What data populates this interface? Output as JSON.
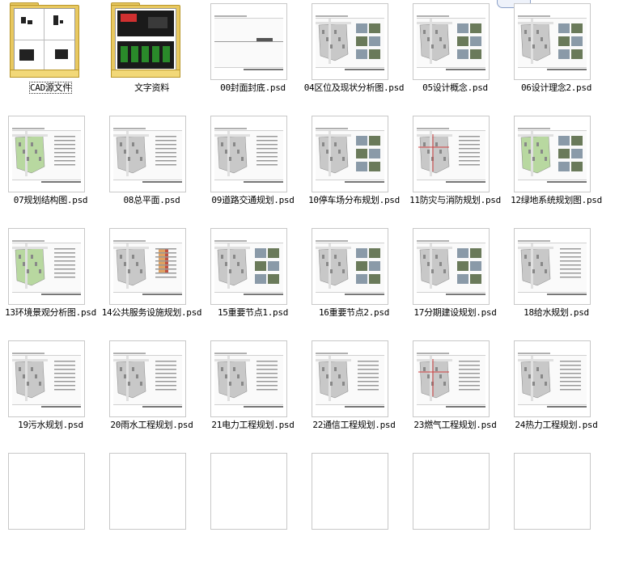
{
  "items": [
    {
      "label": "CAD源文件",
      "kind": "folder",
      "variant": "cad"
    },
    {
      "label": "文字资料",
      "kind": "folder",
      "variant": "text"
    },
    {
      "label": "00封面封底.psd",
      "kind": "file",
      "variant": "cover"
    },
    {
      "label": "04区位及现状分析图.psd",
      "kind": "file",
      "variant": "location"
    },
    {
      "label": "05设计概念.psd",
      "kind": "file",
      "variant": "photos"
    },
    {
      "label": "06设计理念2.psd",
      "kind": "file",
      "variant": "concept"
    },
    {
      "label": "07规划结构图.psd",
      "kind": "file",
      "variant": "plan-green"
    },
    {
      "label": "08总平面.psd",
      "kind": "file",
      "variant": "plan-text"
    },
    {
      "label": "09道路交通规划.psd",
      "kind": "file",
      "variant": "plan-road"
    },
    {
      "label": "10停车场分布规划.psd",
      "kind": "file",
      "variant": "plan-photos"
    },
    {
      "label": "11防灾与消防规划.psd",
      "kind": "file",
      "variant": "plan-red"
    },
    {
      "label": "12绿地系统规划图.psd",
      "kind": "file",
      "variant": "green-system"
    },
    {
      "label": "13环境景观分析图.psd",
      "kind": "file",
      "variant": "landscape"
    },
    {
      "label": "14公共服务设施规划.psd",
      "kind": "file",
      "variant": "plan-chart"
    },
    {
      "label": "15重要节点1.psd",
      "kind": "file",
      "variant": "node1"
    },
    {
      "label": "16重要节点2.psd",
      "kind": "file",
      "variant": "node2"
    },
    {
      "label": "17分期建设规划.psd",
      "kind": "file",
      "variant": "phases"
    },
    {
      "label": "18给水规划.psd",
      "kind": "file",
      "variant": "plan-text"
    },
    {
      "label": "19污水规划.psd",
      "kind": "file",
      "variant": "plan-text"
    },
    {
      "label": "20雨水工程规划.psd",
      "kind": "file",
      "variant": "plan-text"
    },
    {
      "label": "21电力工程规划.psd",
      "kind": "file",
      "variant": "plan-text"
    },
    {
      "label": "22通信工程规划.psd",
      "kind": "file",
      "variant": "plan-text"
    },
    {
      "label": "23燃气工程规划.psd",
      "kind": "file",
      "variant": "plan-red"
    },
    {
      "label": "24热力工程规划.psd",
      "kind": "file",
      "variant": "plan-text"
    },
    {
      "label": "",
      "kind": "file",
      "variant": "partial"
    },
    {
      "label": "",
      "kind": "file",
      "variant": "partial"
    },
    {
      "label": "",
      "kind": "file",
      "variant": "partial"
    },
    {
      "label": "",
      "kind": "file",
      "variant": "partial"
    },
    {
      "label": "",
      "kind": "file",
      "variant": "partial"
    },
    {
      "label": "",
      "kind": "file",
      "variant": "partial"
    }
  ],
  "selected_index": 0,
  "colors": {
    "folder": "#e8c860",
    "map_green": "#b8d8a0",
    "map_gray": "#c8c8c8",
    "road": "#e0e0e0",
    "accent_red": "#d04040"
  }
}
